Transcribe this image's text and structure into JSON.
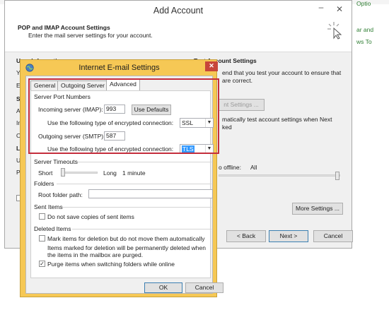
{
  "background": {
    "right_snippets": [
      "Optio",
      "ar and",
      "ws To"
    ]
  },
  "add_account": {
    "title": "Add Account",
    "heading": "POP and IMAP Account Settings",
    "subheading": "Enter the mail server settings for your account.",
    "left_labels": [
      "User Information",
      "Yo",
      "Em",
      "Se",
      "Ac",
      "In",
      "Ou",
      "Lo",
      "Us",
      "Pa"
    ],
    "test_title": "Test Account Settings",
    "test_line1": "end that you test your account to ensure that",
    "test_line2": "are correct.",
    "test_button": "nt Settings ...",
    "auto_line1": "matically test account settings when Next",
    "auto_line2": "ked",
    "offline_label": "o offline:",
    "offline_value": "All",
    "more_settings": "More Settings ...",
    "back": "< Back",
    "next": "Next >",
    "cancel": "Cancel"
  },
  "dialog": {
    "title": "Internet E-mail Settings",
    "close_glyph": "✕",
    "tabs": [
      "General",
      "Outgoing Server",
      "Advanced"
    ],
    "active_tab": "Advanced",
    "server_ports": {
      "title": "Server Port Numbers",
      "incoming_label": "Incoming server (IMAP):",
      "incoming_value": "993",
      "use_defaults": "Use Defaults",
      "encrypt_label_1": "Use the following type of encrypted connection:",
      "encrypt_value_1": "SSL",
      "outgoing_label": "Outgoing server (SMTP):",
      "outgoing_value": "587",
      "encrypt_label_2": "Use the following type of encrypted connection:",
      "encrypt_value_2": "TLS"
    },
    "timeouts": {
      "title": "Server Timeouts",
      "short": "Short",
      "long": "Long",
      "value": "1 minute"
    },
    "folders": {
      "title": "Folders",
      "root_label": "Root folder path:",
      "root_value": ""
    },
    "sent_items": {
      "title": "Sent Items",
      "no_copies": "Do not save copies of sent items",
      "no_copies_checked": false
    },
    "deleted_items": {
      "title": "Deleted Items",
      "mark": "Mark items for deletion but do not move them automatically",
      "mark_checked": false,
      "note_line1": "Items marked for deletion will be permanently deleted when",
      "note_line2": "the items in the mailbox are purged.",
      "purge": "Purge items when switching folders while online",
      "purge_checked": true
    },
    "ok": "OK",
    "cancel": "Cancel"
  },
  "colors": {
    "dialog_frame": "#f6c855",
    "highlight_box": "#c42d3c",
    "close_button": "#c7463a"
  }
}
